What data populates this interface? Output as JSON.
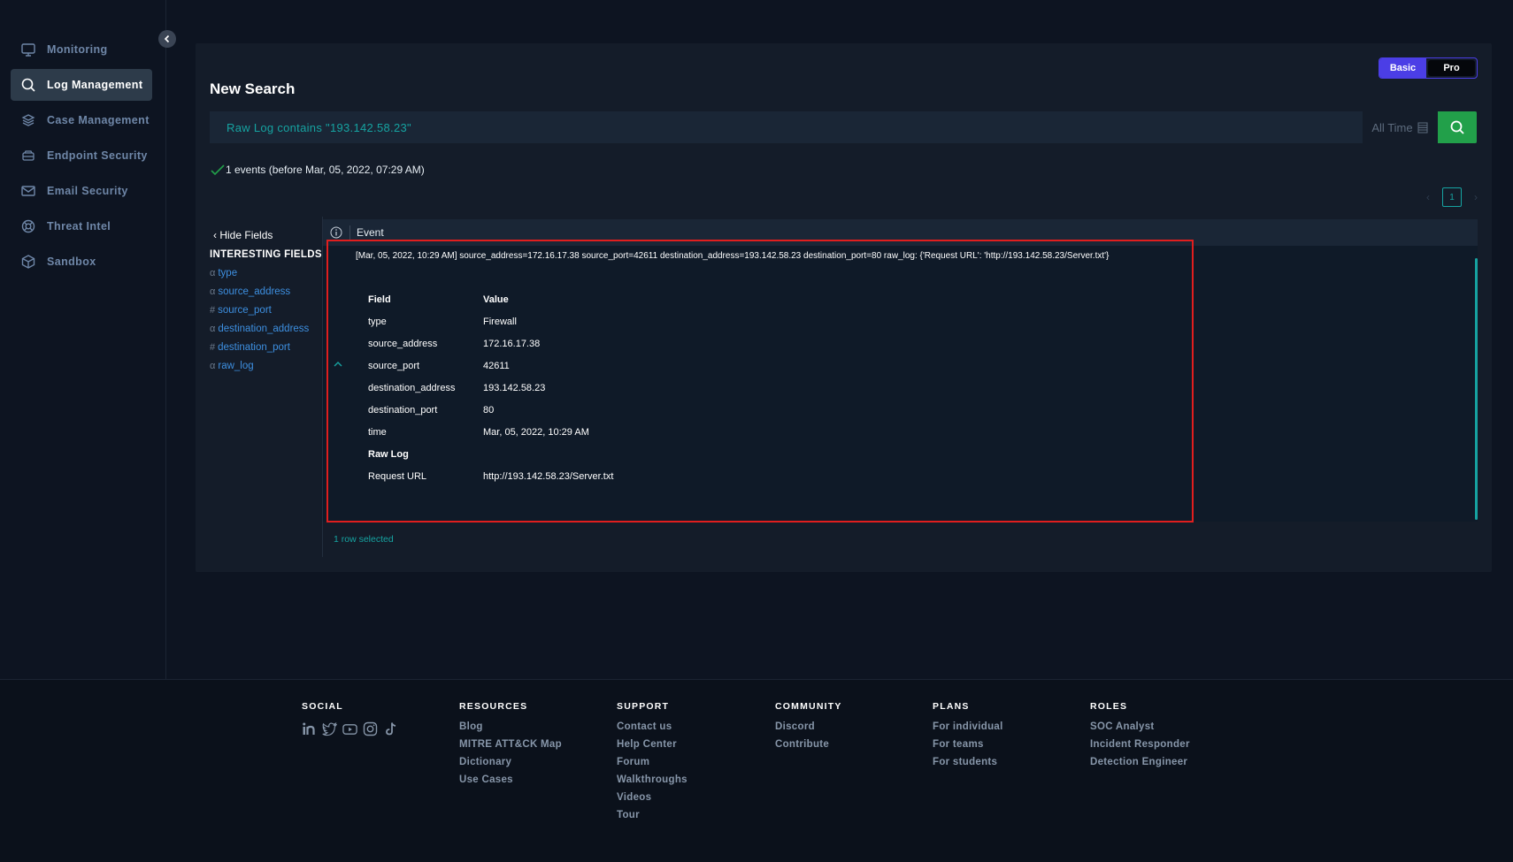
{
  "sidebar": {
    "items": [
      {
        "label": "Monitoring",
        "icon": "monitor-icon",
        "active": false
      },
      {
        "label": "Log Management",
        "icon": "search-icon",
        "active": true
      },
      {
        "label": "Case Management",
        "icon": "layers-icon",
        "active": false
      },
      {
        "label": "Endpoint Security",
        "icon": "drive-icon",
        "active": false
      },
      {
        "label": "Email Security",
        "icon": "mail-icon",
        "active": false
      },
      {
        "label": "Threat Intel",
        "icon": "lifebuoy-icon",
        "active": false
      },
      {
        "label": "Sandbox",
        "icon": "cube-icon",
        "active": false
      }
    ]
  },
  "toggle": {
    "basic": "Basic",
    "pro": "Pro"
  },
  "page_title": "New Search",
  "search": {
    "query": "Raw Log contains \"193.142.58.23\"",
    "time_range": "All Time"
  },
  "result_count": "1 events (before Mar, 05, 2022, 07:29 AM)",
  "pager": {
    "current": "1"
  },
  "fields": {
    "hide_label": "Hide Fields",
    "title": "INTERESTING FIELDS",
    "items": [
      {
        "type": "α",
        "name": "type"
      },
      {
        "type": "α",
        "name": "source_address"
      },
      {
        "type": "#",
        "name": "source_port"
      },
      {
        "type": "α",
        "name": "destination_address"
      },
      {
        "type": "#",
        "name": "destination_port"
      },
      {
        "type": "α",
        "name": "raw_log"
      }
    ]
  },
  "event_table": {
    "header": "Event",
    "raw": "[Mar, 05, 2022, 10:29 AM] source_address=172.16.17.38 source_port=42611 destination_address=193.142.58.23 destination_port=80 raw_log: {'Request URL': 'http://193.142.58.23/Server.txt'}",
    "detail": {
      "field_header": "Field",
      "value_header": "Value",
      "rows": [
        {
          "k": "type",
          "v": "Firewall"
        },
        {
          "k": "source_address",
          "v": "172.16.17.38"
        },
        {
          "k": "source_port",
          "v": "42611"
        },
        {
          "k": "destination_address",
          "v": "193.142.58.23"
        },
        {
          "k": "destination_port",
          "v": "80"
        },
        {
          "k": "time",
          "v": "Mar, 05, 2022, 10:29 AM"
        }
      ],
      "raw_log_header": "Raw Log",
      "raw_rows": [
        {
          "k": "Request URL",
          "v": "http://193.142.58.23/Server.txt"
        }
      ]
    },
    "rows_selected": "1 row selected"
  },
  "footer": {
    "social": {
      "title": "SOCIAL",
      "icons": [
        "linkedin-icon",
        "twitter-icon",
        "youtube-icon",
        "instagram-icon",
        "tiktok-icon"
      ]
    },
    "resources": {
      "title": "RESOURCES",
      "links": [
        "Blog",
        "MITRE ATT&CK Map",
        "Dictionary",
        "Use Cases"
      ]
    },
    "support": {
      "title": "SUPPORT",
      "links": [
        "Contact us",
        "Help Center",
        "Forum",
        "Walkthroughs",
        "Videos",
        "Tour"
      ]
    },
    "community": {
      "title": "COMMUNITY",
      "links": [
        "Discord",
        "Contribute"
      ]
    },
    "plans": {
      "title": "PLANS",
      "links": [
        "For individual",
        "For teams",
        "For students"
      ]
    },
    "roles": {
      "title": "ROLES",
      "links": [
        "SOC Analyst",
        "Incident Responder",
        "Detection Engineer"
      ]
    }
  },
  "colors": {
    "accent": "#16a3a1",
    "search_button": "#22a04a",
    "toggle": "#4b3ee6",
    "highlight": "#e01e1e"
  }
}
